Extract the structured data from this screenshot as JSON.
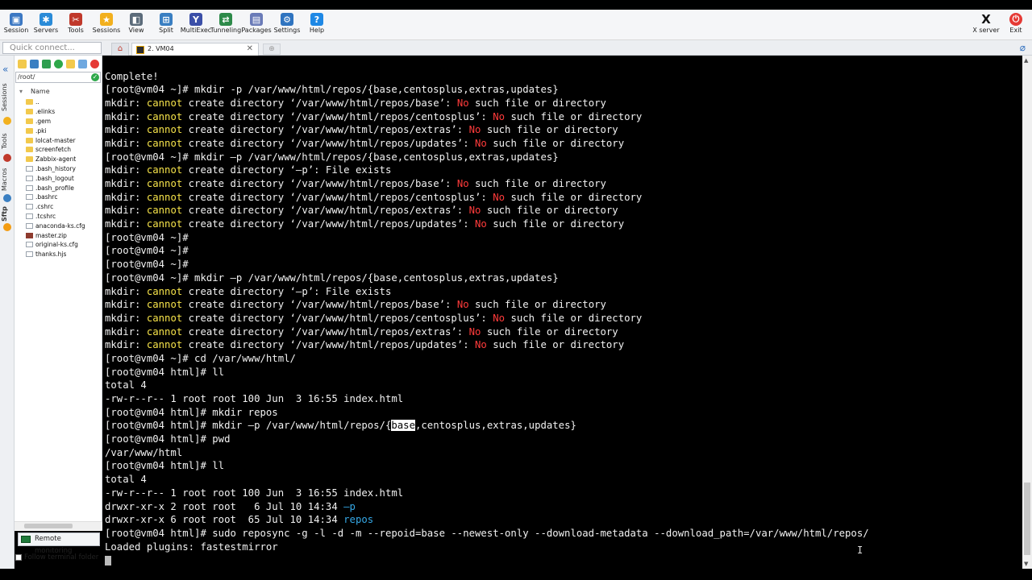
{
  "toolbar": {
    "buttons": [
      {
        "label": "Session",
        "icon": "session-icon",
        "color": "#3c78c3"
      },
      {
        "label": "Servers",
        "icon": "servers-icon",
        "color": "#2a8bd8"
      },
      {
        "label": "Tools",
        "icon": "tools-icon",
        "color": "#c0392b"
      },
      {
        "label": "Sessions",
        "icon": "star-icon",
        "color": "#f2b01e"
      },
      {
        "label": "View",
        "icon": "view-icon",
        "color": "#5b6b7a"
      },
      {
        "label": "Split",
        "icon": "split-icon",
        "color": "#3a7fc2"
      },
      {
        "label": "MultiExec",
        "icon": "multiexec-icon",
        "color": "#3b4fa8"
      },
      {
        "label": "Tunneling",
        "icon": "tunneling-icon",
        "color": "#2d8a4a"
      },
      {
        "label": "Packages",
        "icon": "packages-icon",
        "color": "#6a7bb8"
      },
      {
        "label": "Settings",
        "icon": "gear-icon",
        "color": "#2f74c0"
      },
      {
        "label": "Help",
        "icon": "help-icon",
        "color": "#1e88e5"
      }
    ],
    "xserver_label": "X server",
    "exit_label": "Exit"
  },
  "tabs": {
    "quick_connect_placeholder": "Quick connect...",
    "session_tab": "2. VM04",
    "close_glyph": "✕"
  },
  "side_tabs": [
    "Sessions",
    "Tools",
    "Macros",
    "Sftp"
  ],
  "sftp": {
    "path": "/root/",
    "column_name": "Name",
    "files": [
      {
        "name": "..",
        "type": "folder"
      },
      {
        "name": ".elinks",
        "type": "folder"
      },
      {
        "name": ".gem",
        "type": "folder"
      },
      {
        "name": ".pki",
        "type": "folder"
      },
      {
        "name": "lolcat-master",
        "type": "folder"
      },
      {
        "name": "screenfetch",
        "type": "folder"
      },
      {
        "name": "Zabbix-agent",
        "type": "folder"
      },
      {
        "name": ".bash_history",
        "type": "doc"
      },
      {
        "name": ".bash_logout",
        "type": "doc"
      },
      {
        "name": ".bash_profile",
        "type": "doc"
      },
      {
        "name": ".bashrc",
        "type": "doc"
      },
      {
        "name": ".cshrc",
        "type": "doc"
      },
      {
        "name": ".tcshrc",
        "type": "doc"
      },
      {
        "name": "anaconda-ks.cfg",
        "type": "doc"
      },
      {
        "name": "master.zip",
        "type": "zip"
      },
      {
        "name": "original-ks.cfg",
        "type": "doc"
      },
      {
        "name": "thanks.hjs",
        "type": "doc"
      }
    ],
    "remote_monitoring": "Remote monitoring",
    "follow_terminal": "Follow terminal folder"
  },
  "terminal": {
    "lines": [
      [
        [
          "w",
          "Complete!"
        ]
      ],
      [
        [
          "w",
          "[root@vm04 ~]# mkdir -p /var/www/html/repos/{base,centosplus,extras,updates}"
        ]
      ],
      [
        [
          "w",
          "mkdir: "
        ],
        [
          "y",
          "cannot"
        ],
        [
          "w",
          " create directory ‘/var/www/html/repos/base’: "
        ],
        [
          "r",
          "No"
        ],
        [
          "w",
          " such file or directory"
        ]
      ],
      [
        [
          "w",
          "mkdir: "
        ],
        [
          "y",
          "cannot"
        ],
        [
          "w",
          " create directory ‘/var/www/html/repos/centosplus’: "
        ],
        [
          "r",
          "No"
        ],
        [
          "w",
          " such file or directory"
        ]
      ],
      [
        [
          "w",
          "mkdir: "
        ],
        [
          "y",
          "cannot"
        ],
        [
          "w",
          " create directory ‘/var/www/html/repos/extras’: "
        ],
        [
          "r",
          "No"
        ],
        [
          "w",
          " such file or directory"
        ]
      ],
      [
        [
          "w",
          "mkdir: "
        ],
        [
          "y",
          "cannot"
        ],
        [
          "w",
          " create directory ‘/var/www/html/repos/updates’: "
        ],
        [
          "r",
          "No"
        ],
        [
          "w",
          " such file or directory"
        ]
      ],
      [
        [
          "w",
          "[root@vm04 ~]# mkdir –p /var/www/html/repos/{base,centosplus,extras,updates}"
        ]
      ],
      [
        [
          "w",
          "mkdir: "
        ],
        [
          "y",
          "cannot"
        ],
        [
          "w",
          " create directory ‘–p’: File exists"
        ]
      ],
      [
        [
          "w",
          "mkdir: "
        ],
        [
          "y",
          "cannot"
        ],
        [
          "w",
          " create directory ‘/var/www/html/repos/base’: "
        ],
        [
          "r",
          "No"
        ],
        [
          "w",
          " such file or directory"
        ]
      ],
      [
        [
          "w",
          "mkdir: "
        ],
        [
          "y",
          "cannot"
        ],
        [
          "w",
          " create directory ‘/var/www/html/repos/centosplus’: "
        ],
        [
          "r",
          "No"
        ],
        [
          "w",
          " such file or directory"
        ]
      ],
      [
        [
          "w",
          "mkdir: "
        ],
        [
          "y",
          "cannot"
        ],
        [
          "w",
          " create directory ‘/var/www/html/repos/extras’: "
        ],
        [
          "r",
          "No"
        ],
        [
          "w",
          " such file or directory"
        ]
      ],
      [
        [
          "w",
          "mkdir: "
        ],
        [
          "y",
          "cannot"
        ],
        [
          "w",
          " create directory ‘/var/www/html/repos/updates’: "
        ],
        [
          "r",
          "No"
        ],
        [
          "w",
          " such file or directory"
        ]
      ],
      [
        [
          "w",
          "[root@vm04 ~]#"
        ]
      ],
      [
        [
          "w",
          "[root@vm04 ~]#"
        ]
      ],
      [
        [
          "w",
          "[root@vm04 ~]#"
        ]
      ],
      [
        [
          "w",
          "[root@vm04 ~]# mkdir –p /var/www/html/repos/{base,centosplus,extras,updates}"
        ]
      ],
      [
        [
          "w",
          "mkdir: "
        ],
        [
          "y",
          "cannot"
        ],
        [
          "w",
          " create directory ‘–p’: File exists"
        ]
      ],
      [
        [
          "w",
          "mkdir: "
        ],
        [
          "y",
          "cannot"
        ],
        [
          "w",
          " create directory ‘/var/www/html/repos/base’: "
        ],
        [
          "r",
          "No"
        ],
        [
          "w",
          " such file or directory"
        ]
      ],
      [
        [
          "w",
          "mkdir: "
        ],
        [
          "y",
          "cannot"
        ],
        [
          "w",
          " create directory ‘/var/www/html/repos/centosplus’: "
        ],
        [
          "r",
          "No"
        ],
        [
          "w",
          " such file or directory"
        ]
      ],
      [
        [
          "w",
          "mkdir: "
        ],
        [
          "y",
          "cannot"
        ],
        [
          "w",
          " create directory ‘/var/www/html/repos/extras’: "
        ],
        [
          "r",
          "No"
        ],
        [
          "w",
          " such file or directory"
        ]
      ],
      [
        [
          "w",
          "mkdir: "
        ],
        [
          "y",
          "cannot"
        ],
        [
          "w",
          " create directory ‘/var/www/html/repos/updates’: "
        ],
        [
          "r",
          "No"
        ],
        [
          "w",
          " such file or directory"
        ]
      ],
      [
        [
          "w",
          "[root@vm04 ~]# cd /var/www/html/"
        ]
      ],
      [
        [
          "w",
          "[root@vm04 html]# ll"
        ]
      ],
      [
        [
          "w",
          "total 4"
        ]
      ],
      [
        [
          "w",
          "-rw-r--r-- 1 root root 100 Jun  3 16:55 index.html"
        ]
      ],
      [
        [
          "w",
          "[root@vm04 html]# mkdir repos"
        ]
      ],
      [
        [
          "w",
          "[root@vm04 html]# mkdir –p /var/www/html/repos/{"
        ],
        [
          "sel",
          "base"
        ],
        [
          "w",
          ",centosplus,extras,updates}"
        ]
      ],
      [
        [
          "w",
          "[root@vm04 html]# pwd"
        ]
      ],
      [
        [
          "w",
          "/var/www/html"
        ]
      ],
      [
        [
          "w",
          "[root@vm04 html]# ll"
        ]
      ],
      [
        [
          "w",
          "total 4"
        ]
      ],
      [
        [
          "w",
          "-rw-r--r-- 1 root root 100 Jun  3 16:55 index.html"
        ]
      ],
      [
        [
          "w",
          "drwxr-xr-x 2 root root   6 Jul 10 14:34 "
        ],
        [
          "b",
          "–p"
        ]
      ],
      [
        [
          "w",
          "drwxr-xr-x 6 root root  65 Jul 10 14:34 "
        ],
        [
          "b",
          "repos"
        ]
      ],
      [
        [
          "w",
          "[root@vm04 html]# sudo reposync -g -l -d -m --repoid=base --newest-only --download-metadata --download_path=/var/www/html/repos/"
        ]
      ],
      [
        [
          "w",
          "Loaded plugins: fastestmirror"
        ]
      ]
    ]
  }
}
